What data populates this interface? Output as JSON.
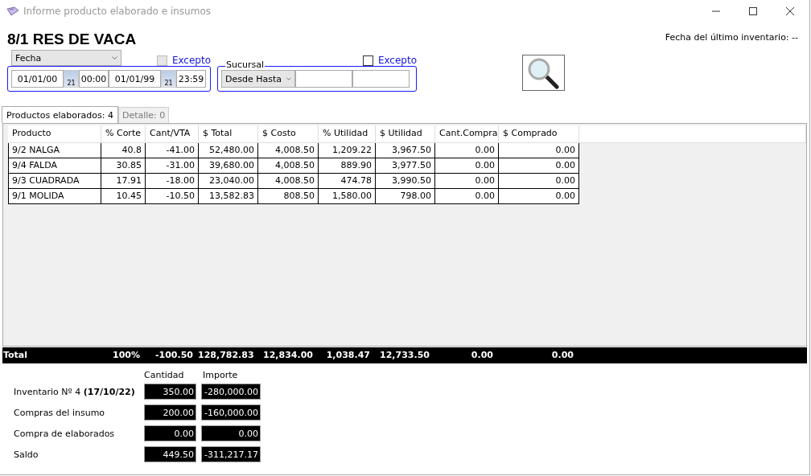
{
  "window": {
    "title": "Informe producto elaborado e insumos"
  },
  "heading": "8/1 RES DE VACA",
  "last_inventory": "Fecha del último inventario: --",
  "date_filter": {
    "field": "Fecha",
    "except_label": "Excepto",
    "except_checked": false,
    "except_disabled": true,
    "from_date": "01/01/00",
    "from_time": "00:00",
    "to_date": "01/01/99",
    "to_time": "23:59",
    "from_calendar_day": "21",
    "to_calendar_day": "21"
  },
  "branch_filter": {
    "legend": "Sucursal",
    "except_label": "Excepto",
    "except_checked": false,
    "except_disabled": false,
    "mode": "Desde Hasta"
  },
  "tabs": [
    {
      "label": "Productos elaborados: 4",
      "selected": true
    },
    {
      "label": "Detalle: 0",
      "selected": false
    }
  ],
  "table": {
    "columns": [
      "Producto",
      "% Corte",
      "Cant/VTA",
      "$ Total",
      "$ Costo",
      "% Utilidad",
      "$ Utilidad",
      "Cant.Compra",
      "$ Comprado"
    ],
    "rows": [
      [
        "9/2 NALGA",
        "40.8",
        "-41.00",
        "52,480.00",
        "4,008.50",
        "1,209.22",
        "3,967.50",
        "0.00",
        "0.00"
      ],
      [
        "9/4 FALDA",
        "30.85",
        "-31.00",
        "39,680.00",
        "4,008.50",
        "889.90",
        "3,977.50",
        "0.00",
        "0.00"
      ],
      [
        "9/3 CUADRADA",
        "17.91",
        "-18.00",
        "23,040.00",
        "4,008.50",
        "474.78",
        "3,990.50",
        "0.00",
        "0.00"
      ],
      [
        "9/1 MOLIDA",
        "10.45",
        "-10.50",
        "13,582.83",
        "808.50",
        "1,580.00",
        "798.00",
        "0.00",
        "0.00"
      ]
    ],
    "totals": [
      "Total",
      "100%",
      "-100.50",
      "128,782.83",
      "12,834.00",
      "1,038.47",
      "12,733.50",
      "0.00",
      "0.00"
    ]
  },
  "summary": {
    "columns": [
      "Cantidad",
      "Importe"
    ],
    "rows": [
      {
        "label": "Inventario Nº 4 **(17/10/22)**",
        "cantidad": "350.00",
        "importe": "-280,000.00"
      },
      {
        "label": "Compras del insumo",
        "cantidad": "200.00",
        "importe": "-160,000.00"
      },
      {
        "label": "Compra de elaborados",
        "cantidad": "0.00",
        "importe": "0.00"
      },
      {
        "label": "Saldo",
        "cantidad": "449.50",
        "importe": "-311,217.17"
      }
    ]
  }
}
